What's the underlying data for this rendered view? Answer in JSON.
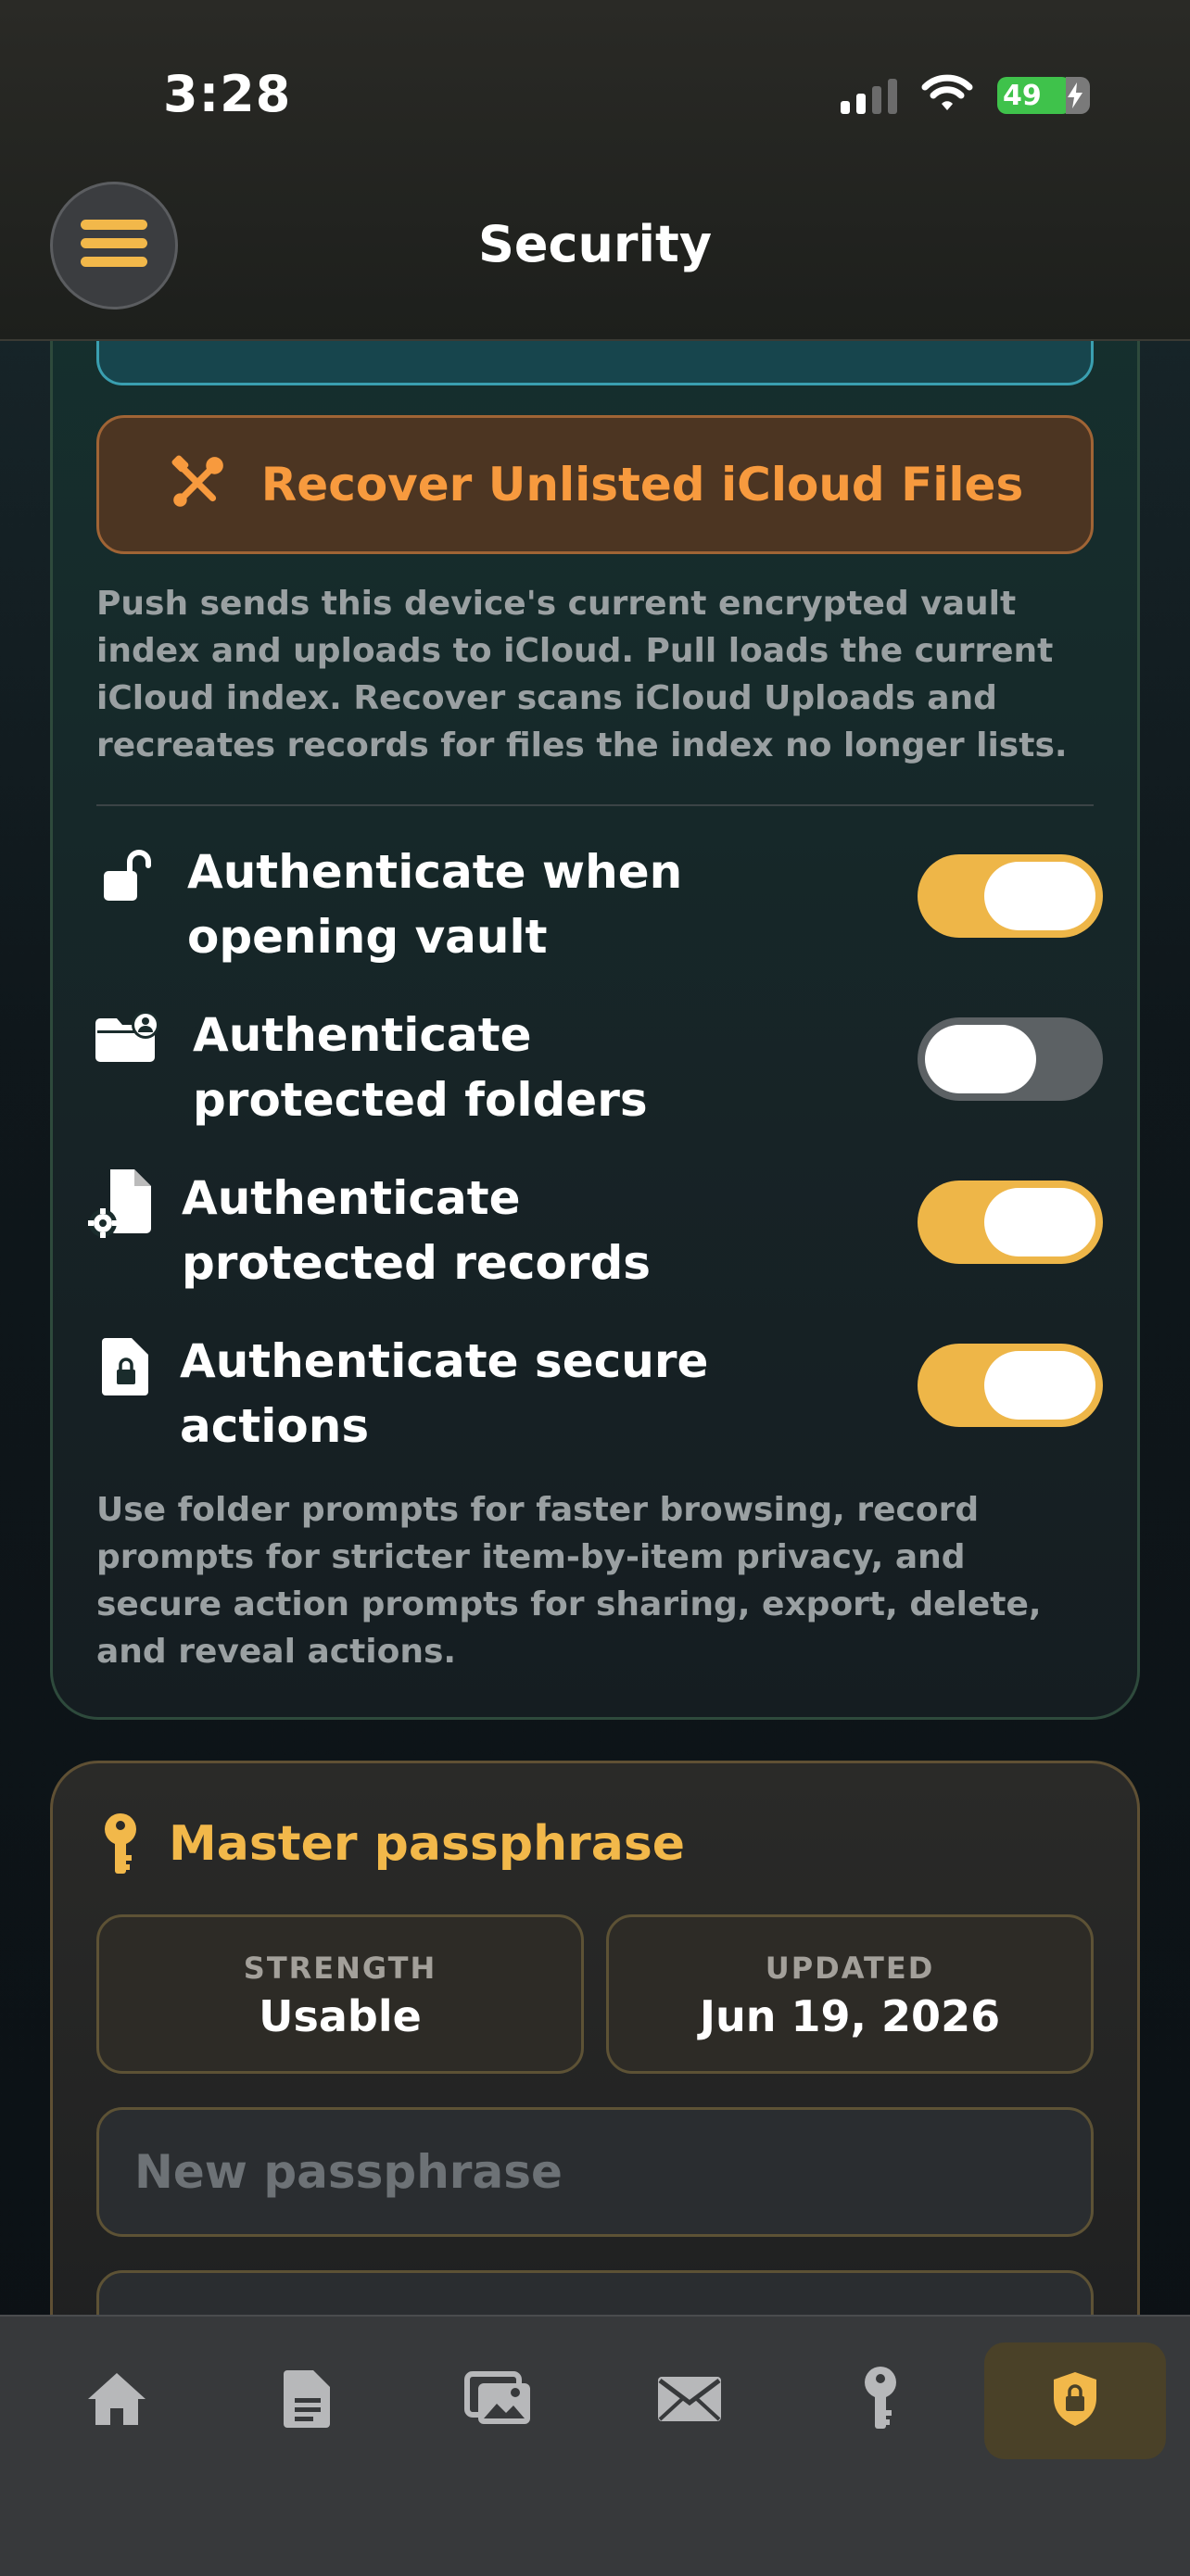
{
  "status_bar": {
    "time": "3:28",
    "battery": "49"
  },
  "header": {
    "title": "Security"
  },
  "sync": {
    "recover_label": "Recover Unlisted iCloud Files",
    "description": "Push sends this device's current encrypted vault index and uploads to iCloud. Pull loads the current iCloud index. Recover scans iCloud Uploads and recreates records for files the index no longer lists."
  },
  "auth_settings": {
    "items": [
      {
        "label": "Authenticate when opening vault",
        "icon": "unlock-icon",
        "enabled": true
      },
      {
        "label": "Authenticate protected folders",
        "icon": "folder-person-icon",
        "enabled": false
      },
      {
        "label": "Authenticate protected records",
        "icon": "document-gear-icon",
        "enabled": true
      },
      {
        "label": "Authenticate secure actions",
        "icon": "document-lock-icon",
        "enabled": true
      }
    ],
    "footnote": "Use folder prompts for faster browsing, record prompts for stricter item-by-item privacy, and secure action prompts for sharing, export, delete, and reveal actions."
  },
  "master_passphrase": {
    "title": "Master passphrase",
    "strength_label": "STRENGTH",
    "strength_value": "Usable",
    "updated_label": "UPDATED",
    "updated_value": "Jun 19, 2026",
    "new_placeholder": "New passphrase"
  },
  "tabbar": {
    "items": [
      {
        "icon": "home-icon"
      },
      {
        "icon": "document-icon"
      },
      {
        "icon": "photos-icon"
      },
      {
        "icon": "mail-icon"
      },
      {
        "icon": "key-icon"
      },
      {
        "icon": "shield-lock-icon",
        "active": true
      }
    ]
  },
  "colors": {
    "accent": "#eeb648",
    "recover": "#f79a3e",
    "toggle_off": "#5c6164"
  }
}
